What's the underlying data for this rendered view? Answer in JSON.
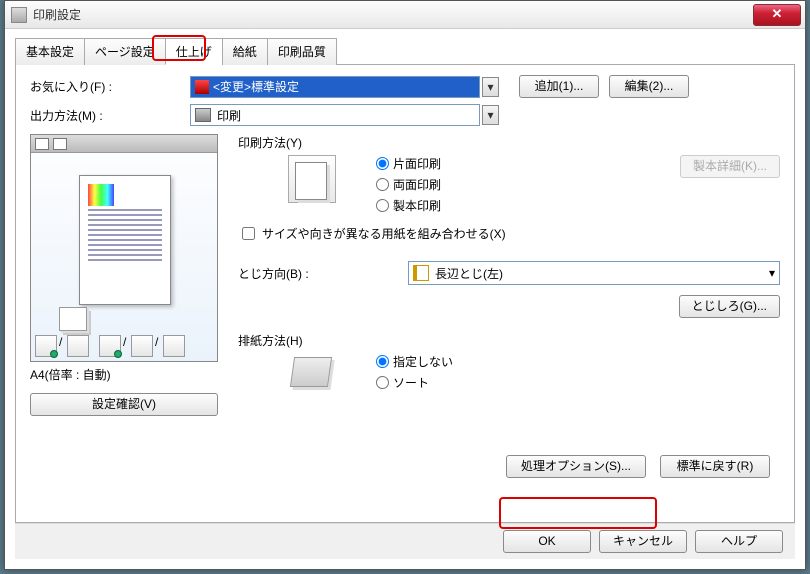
{
  "window": {
    "title": "印刷設定"
  },
  "tabs": [
    "基本設定",
    "ページ設定",
    "仕上げ",
    "給紙",
    "印刷品質"
  ],
  "active_tab_index": 2,
  "favorite": {
    "label": "お気に入り(F) :",
    "value": "<変更>標準設定",
    "add_btn": "追加(1)...",
    "edit_btn": "編集(2)..."
  },
  "output": {
    "label": "出力方法(M) :",
    "value": "印刷"
  },
  "preview": {
    "caption": "A4(倍率 : 自動)"
  },
  "confirm_btn": "設定確認(V)",
  "print_method": {
    "label": "印刷方法(Y)",
    "options": [
      "片面印刷",
      "両面印刷",
      "製本印刷"
    ],
    "selected": 0,
    "detail_btn": "製本詳細(K)..."
  },
  "combine": {
    "label": "サイズや向きが異なる用紙を組み合わせる(X)"
  },
  "binding": {
    "label": "とじ方向(B) :",
    "value": "長辺とじ(左)",
    "gutter_btn": "とじしろ(G)..."
  },
  "eject": {
    "label": "排紙方法(H)",
    "options": [
      "指定しない",
      "ソート"
    ],
    "selected": 0
  },
  "bottom": {
    "process_btn": "処理オプション(S)...",
    "restore_btn": "標準に戻す(R)"
  },
  "dialog": {
    "ok": "OK",
    "cancel": "キャンセル",
    "help": "ヘルプ"
  }
}
